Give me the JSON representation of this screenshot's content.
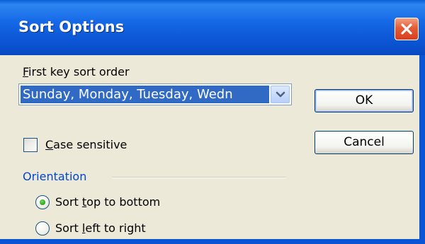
{
  "window": {
    "title": "Sort Options",
    "close_icon": "close-icon"
  },
  "first_key": {
    "label_accel": "F",
    "label_rest": "irst key sort order",
    "selected_value": "Sunday, Monday, Tuesday, Wedn",
    "dropdown_icon": "chevron-down-icon"
  },
  "buttons": {
    "ok": "OK",
    "cancel": "Cancel"
  },
  "case_sensitive": {
    "accel": "C",
    "rest": "ase sensitive",
    "checked": false
  },
  "orientation": {
    "label": "Orientation",
    "options": [
      {
        "before": "Sort ",
        "accel": "t",
        "after": "op to bottom",
        "selected": true
      },
      {
        "before": "Sort ",
        "accel": "l",
        "after": "eft to right",
        "selected": false
      }
    ]
  },
  "colors": {
    "titlebar": "#0a55d6",
    "selection": "#316ac5",
    "group_label": "#0046d5",
    "dialog_bg": "#ece9d8"
  }
}
